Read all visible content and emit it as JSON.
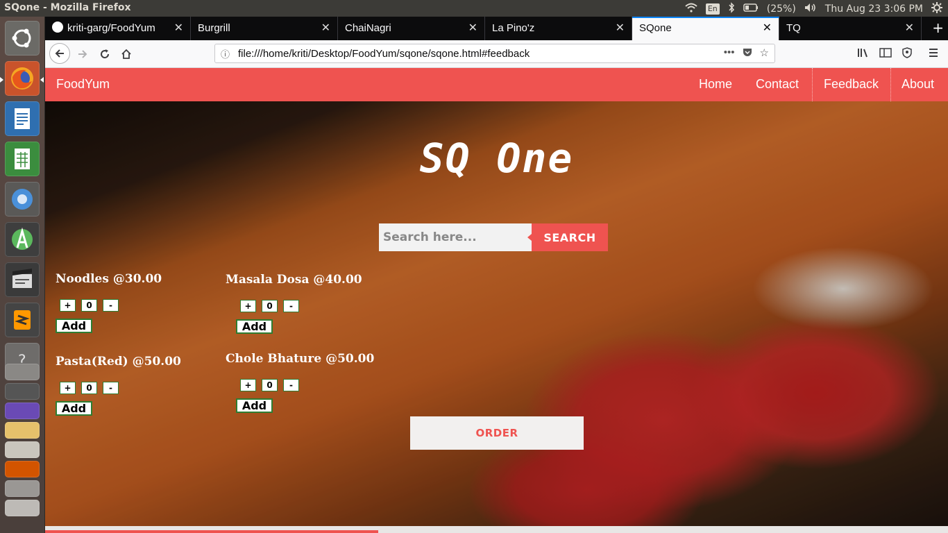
{
  "system": {
    "window_title": "SQone - Mozilla Firefox",
    "lang": "En",
    "battery": "(25%)",
    "datetime": "Thu Aug 23  3:06 PM"
  },
  "browser": {
    "tabs": [
      {
        "label": "kriti-garg/FoodYum"
      },
      {
        "label": "Burgrill"
      },
      {
        "label": "ChaiNagri"
      },
      {
        "label": "La Pino'z"
      },
      {
        "label": "SQone"
      },
      {
        "label": "TQ"
      }
    ],
    "active_tab": "SQone",
    "url": "file:///home/kriti/Desktop/FoodYum/sqone/sqone.html#feedback"
  },
  "site": {
    "brand": "FoodYum",
    "nav": [
      "Home",
      "Contact",
      "Feedback",
      "About"
    ],
    "title": "SQ One",
    "search_placeholder": "Search here...",
    "search_button": "SEARCH",
    "order_button": "ORDER",
    "items": [
      {
        "name": "Noodles @30.00",
        "qty": "0",
        "plus": "+",
        "minus": "-",
        "add": "Add"
      },
      {
        "name": "Pasta(Red) @50.00",
        "qty": "0",
        "plus": "+",
        "minus": "-",
        "add": "Add"
      },
      {
        "name": "Masala Dosa @40.00",
        "qty": "0",
        "plus": "+",
        "minus": "-",
        "add": "Add"
      },
      {
        "name": "Chole Bhature @50.00",
        "qty": "0",
        "plus": "+",
        "minus": "-",
        "add": "Add"
      }
    ]
  },
  "colors": {
    "accent": "#ef5350",
    "add_border": "#2e7d32",
    "firefox_tab_bg": "#0c0c0d"
  }
}
